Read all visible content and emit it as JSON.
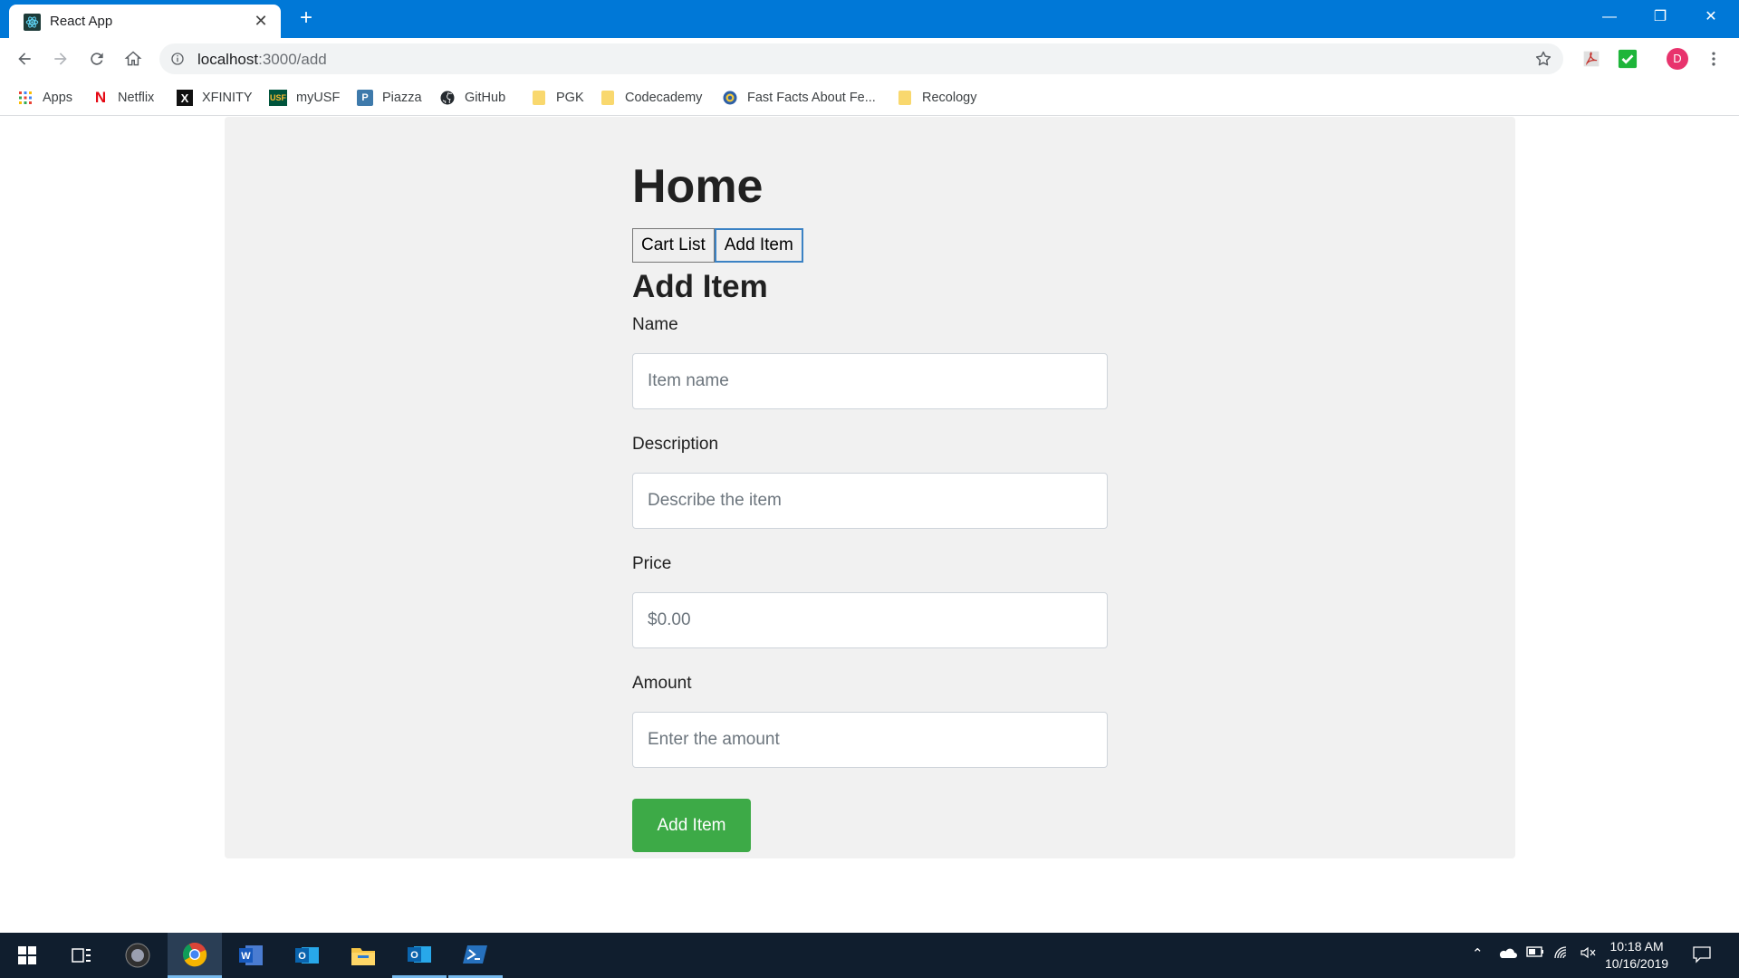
{
  "browser": {
    "tab": {
      "title": "React App",
      "favicon": "react-icon"
    },
    "url": {
      "host": "localhost",
      "path": ":3000/add"
    },
    "window_controls": {
      "minimize": "—",
      "restore": "❐",
      "close": "✕"
    }
  },
  "bookmarks": [
    {
      "label": "Apps",
      "icon": "apps-grid-icon"
    },
    {
      "label": "Netflix",
      "icon": "netflix-icon"
    },
    {
      "label": "XFINITY",
      "icon": "xfinity-icon"
    },
    {
      "label": "myUSF",
      "icon": "usf-icon"
    },
    {
      "label": "Piazza",
      "icon": "piazza-icon"
    },
    {
      "label": "GitHub",
      "icon": "github-icon"
    },
    {
      "label": "PGK",
      "icon": "folder-icon"
    },
    {
      "label": "Codecademy",
      "icon": "folder-icon"
    },
    {
      "label": "Fast Facts About Fe...",
      "icon": "site-icon"
    },
    {
      "label": "Recology",
      "icon": "folder-icon"
    }
  ],
  "profile": {
    "initial": "D",
    "color": "#e8336d"
  },
  "page": {
    "heading": "Home",
    "nav": {
      "cart_list": "Cart List",
      "add_item": "Add Item"
    },
    "form": {
      "title": "Add Item",
      "name": {
        "label": "Name",
        "placeholder": "Item name"
      },
      "description": {
        "label": "Description",
        "placeholder": "Describe the item"
      },
      "price": {
        "label": "Price",
        "placeholder": "$0.00"
      },
      "amount": {
        "label": "Amount",
        "placeholder": "Enter the amount"
      },
      "submit": "Add Item"
    },
    "colors": {
      "submit": "#3daa47",
      "background": "#f1f1f1"
    }
  },
  "taskbar": {
    "apps": [
      "start-icon",
      "task-view-icon",
      "obs-icon",
      "chrome-icon",
      "word-icon",
      "outlook-icon",
      "file-explorer-icon",
      "outlook-icon",
      "powershell-icon"
    ],
    "time": "10:18 AM",
    "date": "10/16/2019"
  }
}
